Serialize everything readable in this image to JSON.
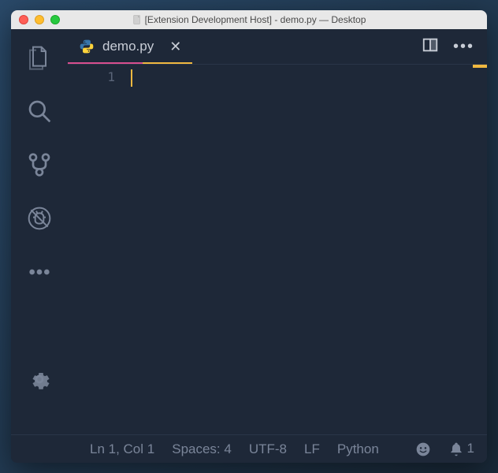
{
  "titlebar": {
    "text": "[Extension Development Host] - demo.py — Desktop"
  },
  "tabs": {
    "active": {
      "label": "demo.py"
    }
  },
  "editor": {
    "line_number": "1"
  },
  "status": {
    "position": "Ln 1, Col 1",
    "spaces": "Spaces: 4",
    "encoding": "UTF-8",
    "eol": "LF",
    "language": "Python",
    "notifications": "1"
  }
}
